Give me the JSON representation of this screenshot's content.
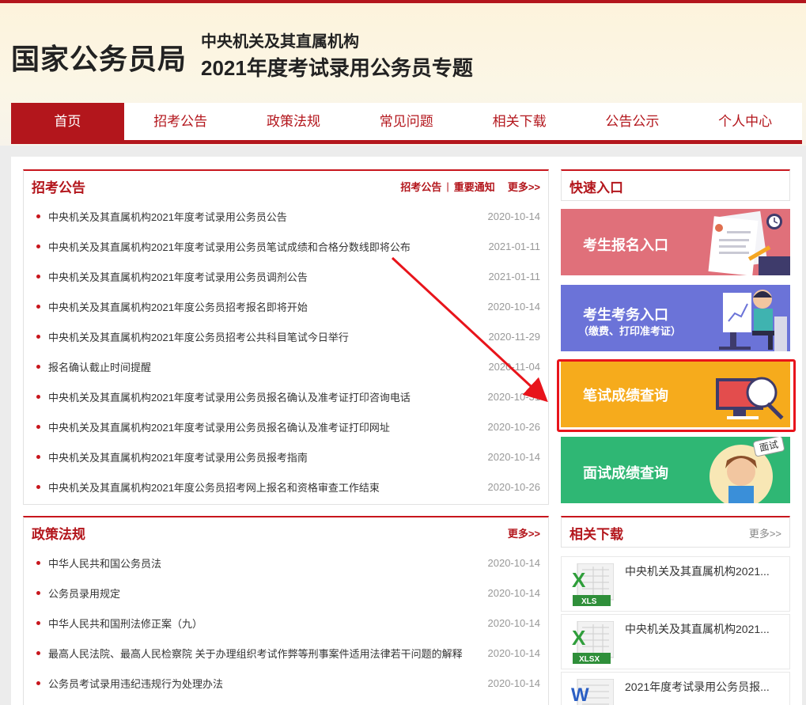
{
  "header": {
    "logo": "国家公务员局",
    "subtitle1": "中央机关及其直属机构",
    "subtitle2": "2021年度考试录用公务员专题"
  },
  "nav": {
    "items": [
      "首页",
      "招考公告",
      "政策法规",
      "常见问题",
      "相关下载",
      "公告公示",
      "个人中心"
    ]
  },
  "recruit": {
    "title": "招考公告",
    "link1": "招考公告",
    "link2": "重要通知",
    "more": "更多>>",
    "items": [
      {
        "title": "中央机关及其直属机构2021年度考试录用公务员公告",
        "date": "2020-10-14"
      },
      {
        "title": "中央机关及其直属机构2021年度考试录用公务员笔试成绩和合格分数线即将公布",
        "date": "2021-01-11"
      },
      {
        "title": "中央机关及其直属机构2021年度考试录用公务员调剂公告",
        "date": "2021-01-11"
      },
      {
        "title": "中央机关及其直属机构2021年度公务员招考报名即将开始",
        "date": "2020-10-14"
      },
      {
        "title": "中央机关及其直属机构2021年度公务员招考公共科目笔试今日举行",
        "date": "2020-11-29"
      },
      {
        "title": "报名确认截止时间提醒",
        "date": "2020-11-04"
      },
      {
        "title": "中央机关及其直属机构2021年度考试录用公务员报名确认及准考证打印咨询电话",
        "date": "2020-10-31"
      },
      {
        "title": "中央机关及其直属机构2021年度考试录用公务员报名确认及准考证打印网址",
        "date": "2020-10-26"
      },
      {
        "title": "中央机关及其直属机构2021年度考试录用公务员报考指南",
        "date": "2020-10-14"
      },
      {
        "title": "中央机关及其直属机构2021年度公务员招考网上报名和资格审查工作结束",
        "date": "2020-10-26"
      }
    ]
  },
  "policy": {
    "title": "政策法规",
    "more": "更多>>",
    "items": [
      {
        "title": "中华人民共和国公务员法",
        "date": "2020-10-14"
      },
      {
        "title": "公务员录用规定",
        "date": "2020-10-14"
      },
      {
        "title": "中华人民共和国刑法修正案（九）",
        "date": "2020-10-14"
      },
      {
        "title": "最高人民法院、最高人民检察院 关于办理组织考试作弊等刑事案件适用法律若干问题的解释",
        "date": "2020-10-14"
      },
      {
        "title": "公务员考试录用违纪违规行为处理办法",
        "date": "2020-10-14"
      }
    ]
  },
  "quick": {
    "title": "快速入口",
    "cards": [
      {
        "label": "考生报名入口",
        "color": "#e0707a"
      },
      {
        "label": "考生考务入口",
        "sub": "（缴费、打印准考证）",
        "color": "#6b73d8"
      },
      {
        "label": "笔试成绩查询",
        "color": "#f6ab1c"
      },
      {
        "label": "面试成绩查询",
        "color": "#2fb774",
        "badge": "面试"
      }
    ]
  },
  "downloads": {
    "title": "相关下载",
    "more": "更多>>",
    "items": [
      {
        "name": "中央机关及其直属机构2021...",
        "type": "XLS"
      },
      {
        "name": "中央机关及其直属机构2021...",
        "type": "XLSX"
      },
      {
        "name": "2021年度考试录用公务员报...",
        "type": "W"
      }
    ]
  }
}
